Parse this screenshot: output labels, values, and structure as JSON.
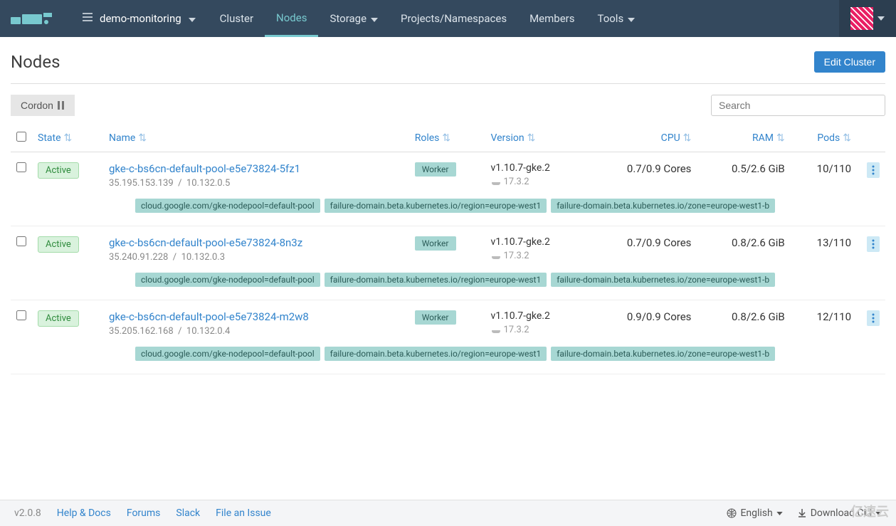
{
  "header": {
    "cluster_name": "demo-monitoring",
    "nav": {
      "cluster": "Cluster",
      "nodes": "Nodes",
      "storage": "Storage",
      "projects": "Projects/Namespaces",
      "members": "Members",
      "tools": "Tools"
    }
  },
  "page": {
    "title": "Nodes",
    "edit_cluster_btn": "Edit Cluster",
    "cordon_btn": "Cordon",
    "search_placeholder": "Search"
  },
  "columns": {
    "state": "State",
    "name": "Name",
    "roles": "Roles",
    "version": "Version",
    "cpu": "CPU",
    "ram": "RAM",
    "pods": "Pods"
  },
  "nodes": [
    {
      "state": "Active",
      "name": "gke-c-bs6cn-default-pool-e5e73824-5fz1",
      "external_ip": "35.195.153.139",
      "internal_ip": "10.132.0.5",
      "role": "Worker",
      "version": "v1.10.7-gke.2",
      "docker_version": "17.3.2",
      "cpu": "0.7/0.9 Cores",
      "ram": "0.5/2.6 GiB",
      "pods": "10/110",
      "labels": [
        "cloud.google.com/gke-nodepool=default-pool",
        "failure-domain.beta.kubernetes.io/region=europe-west1",
        "failure-domain.beta.kubernetes.io/zone=europe-west1-b"
      ]
    },
    {
      "state": "Active",
      "name": "gke-c-bs6cn-default-pool-e5e73824-8n3z",
      "external_ip": "35.240.91.228",
      "internal_ip": "10.132.0.3",
      "role": "Worker",
      "version": "v1.10.7-gke.2",
      "docker_version": "17.3.2",
      "cpu": "0.7/0.9 Cores",
      "ram": "0.8/2.6 GiB",
      "pods": "13/110",
      "labels": [
        "cloud.google.com/gke-nodepool=default-pool",
        "failure-domain.beta.kubernetes.io/region=europe-west1",
        "failure-domain.beta.kubernetes.io/zone=europe-west1-b"
      ]
    },
    {
      "state": "Active",
      "name": "gke-c-bs6cn-default-pool-e5e73824-m2w8",
      "external_ip": "35.205.162.168",
      "internal_ip": "10.132.0.4",
      "role": "Worker",
      "version": "v1.10.7-gke.2",
      "docker_version": "17.3.2",
      "cpu": "0.9/0.9 Cores",
      "ram": "0.8/2.6 GiB",
      "pods": "12/110",
      "labels": [
        "cloud.google.com/gke-nodepool=default-pool",
        "failure-domain.beta.kubernetes.io/region=europe-west1",
        "failure-domain.beta.kubernetes.io/zone=europe-west1-b"
      ]
    }
  ],
  "footer": {
    "version": "v2.0.8",
    "help": "Help & Docs",
    "forums": "Forums",
    "slack": "Slack",
    "file_issue": "File an Issue",
    "language": "English",
    "download_cli": "Download CLI"
  },
  "watermark": "亿速云"
}
